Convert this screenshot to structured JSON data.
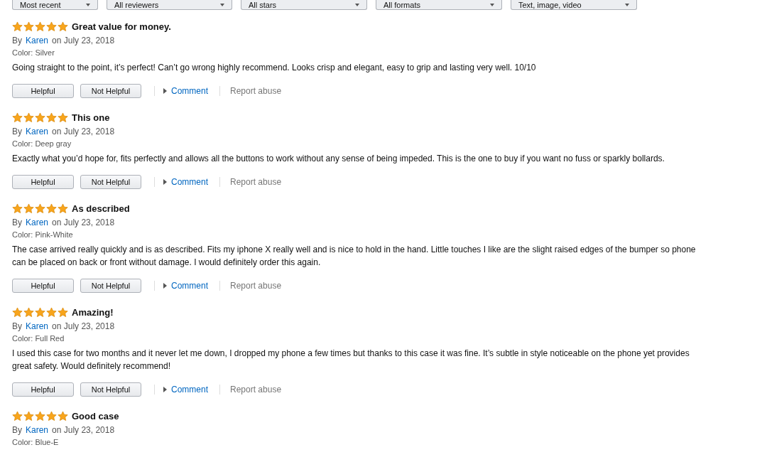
{
  "filters": [
    "Most recent",
    "All reviewers",
    "All stars",
    "All formats",
    "Text, image, video"
  ],
  "reviews": [
    {
      "stars": 5,
      "title": "Great value for money.",
      "by": "By",
      "author": "Karen",
      "date": "on July 23, 2018",
      "variant": "Color: Silver",
      "body": "Going straight to the point, it’s perfect! Can’t go wrong highly recommend. Looks crisp and elegant, easy to grip and lasting very well. 10/10",
      "helpful": "Helpful",
      "not_helpful": "Not Helpful",
      "comment": "Comment",
      "report": "Report abuse"
    },
    {
      "stars": 5,
      "title": "This one",
      "by": "By",
      "author": "Karen",
      "date": "on July 23, 2018",
      "variant": "Color: Deep gray",
      "body": "Exactly what you’d hope for, fits perfectly and allows all the buttons to work without any sense of being impeded. This is the one to buy if you want no fuss or sparkly bollards.",
      "helpful": "Helpful",
      "not_helpful": "Not Helpful",
      "comment": "Comment",
      "report": "Report abuse"
    },
    {
      "stars": 5,
      "title": "As described",
      "by": "By",
      "author": "Karen",
      "date": "on July 23, 2018",
      "variant": "Color: Pink-White",
      "body": "The case arrived really quickly and is as described. Fits my iphone X really well and is nice to hold in the hand. Little touches I like are the slight raised edges of the bumper so phone can be placed on back or front without damage. I would definitely order this again.",
      "helpful": "Helpful",
      "not_helpful": "Not Helpful",
      "comment": "Comment",
      "report": "Report abuse"
    },
    {
      "stars": 5,
      "title": "Amazing!",
      "by": "By",
      "author": "Karen",
      "date": "on July 23, 2018",
      "variant": "Color: Full Red",
      "body": "I used this case for two months and it never let me down, I dropped my phone a few times but thanks to this case it was fine. It’s subtle in style noticeable on the phone yet provides great safety. Would definitely recommend!",
      "helpful": "Helpful",
      "not_helpful": "Not Helpful",
      "comment": "Comment",
      "report": "Report abuse"
    },
    {
      "stars": 5,
      "title": "Good case",
      "by": "By",
      "author": "Karen",
      "date": "on July 23, 2018",
      "variant": "Color: Blue-E"
    }
  ]
}
